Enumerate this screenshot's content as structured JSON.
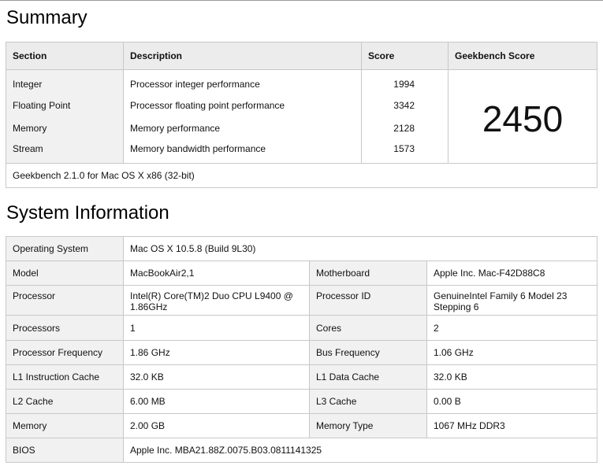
{
  "summary": {
    "heading": "Summary",
    "headers": {
      "section": "Section",
      "description": "Description",
      "score": "Score",
      "geekbench": "Geekbench Score"
    },
    "rows": [
      {
        "section": "Integer",
        "description": "Processor integer performance",
        "score": "1994"
      },
      {
        "section": "Floating Point",
        "description": "Processor floating point performance",
        "score": "3342"
      },
      {
        "section": "Memory",
        "description": "Memory performance",
        "score": "2128"
      },
      {
        "section": "Stream",
        "description": "Memory bandwidth performance",
        "score": "1573"
      }
    ],
    "geekbench_score": "2450",
    "footer": "Geekbench 2.1.0 for Mac OS X x86 (32-bit)"
  },
  "system": {
    "heading": "System Information",
    "os_label": "Operating System",
    "os_value": "Mac OS X 10.5.8 (Build 9L30)",
    "pairs": [
      {
        "l1": "Model",
        "v1": "MacBookAir2,1",
        "l2": "Motherboard",
        "v2": "Apple Inc. Mac-F42D88C8"
      },
      {
        "l1": "Processor",
        "v1": "Intel(R) Core(TM)2 Duo CPU L9400 @ 1.86GHz",
        "l2": "Processor ID",
        "v2": "GenuineIntel Family 6 Model 23 Stepping 6"
      },
      {
        "l1": "Processors",
        "v1": "1",
        "l2": "Cores",
        "v2": "2"
      },
      {
        "l1": "Processor Frequency",
        "v1": "1.86 GHz",
        "l2": "Bus Frequency",
        "v2": "1.06 GHz"
      },
      {
        "l1": "L1 Instruction Cache",
        "v1": "32.0 KB",
        "l2": "L1 Data Cache",
        "v2": "32.0 KB"
      },
      {
        "l1": "L2 Cache",
        "v1": "6.00 MB",
        "l2": "L3 Cache",
        "v2": "0.00 B"
      },
      {
        "l1": "Memory",
        "v1": "2.00 GB",
        "l2": "Memory Type",
        "v2": "1067 MHz DDR3"
      }
    ],
    "bios_label": "BIOS",
    "bios_value": "Apple Inc. MBA21.88Z.0075.B03.0811141325"
  }
}
